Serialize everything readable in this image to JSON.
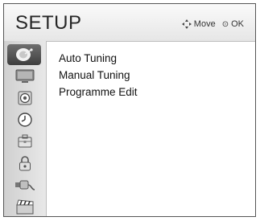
{
  "header": {
    "title": "SETUP",
    "hint_move": "Move",
    "hint_ok": "OK"
  },
  "sidebar": {
    "items": [
      {
        "icon": "satellite-dish-icon",
        "active": true
      },
      {
        "icon": "monitor-picture-icon",
        "active": false
      },
      {
        "icon": "speaker-audio-icon",
        "active": false
      },
      {
        "icon": "clock-time-icon",
        "active": false
      },
      {
        "icon": "options-briefcase-icon",
        "active": false
      },
      {
        "icon": "padlock-lock-icon",
        "active": false
      },
      {
        "icon": "input-plug-icon",
        "active": false
      },
      {
        "icon": "clapperboard-icon",
        "active": false
      }
    ]
  },
  "menu": {
    "items": [
      {
        "label": "Auto Tuning"
      },
      {
        "label": "Manual Tuning"
      },
      {
        "label": "Programme Edit"
      }
    ]
  }
}
